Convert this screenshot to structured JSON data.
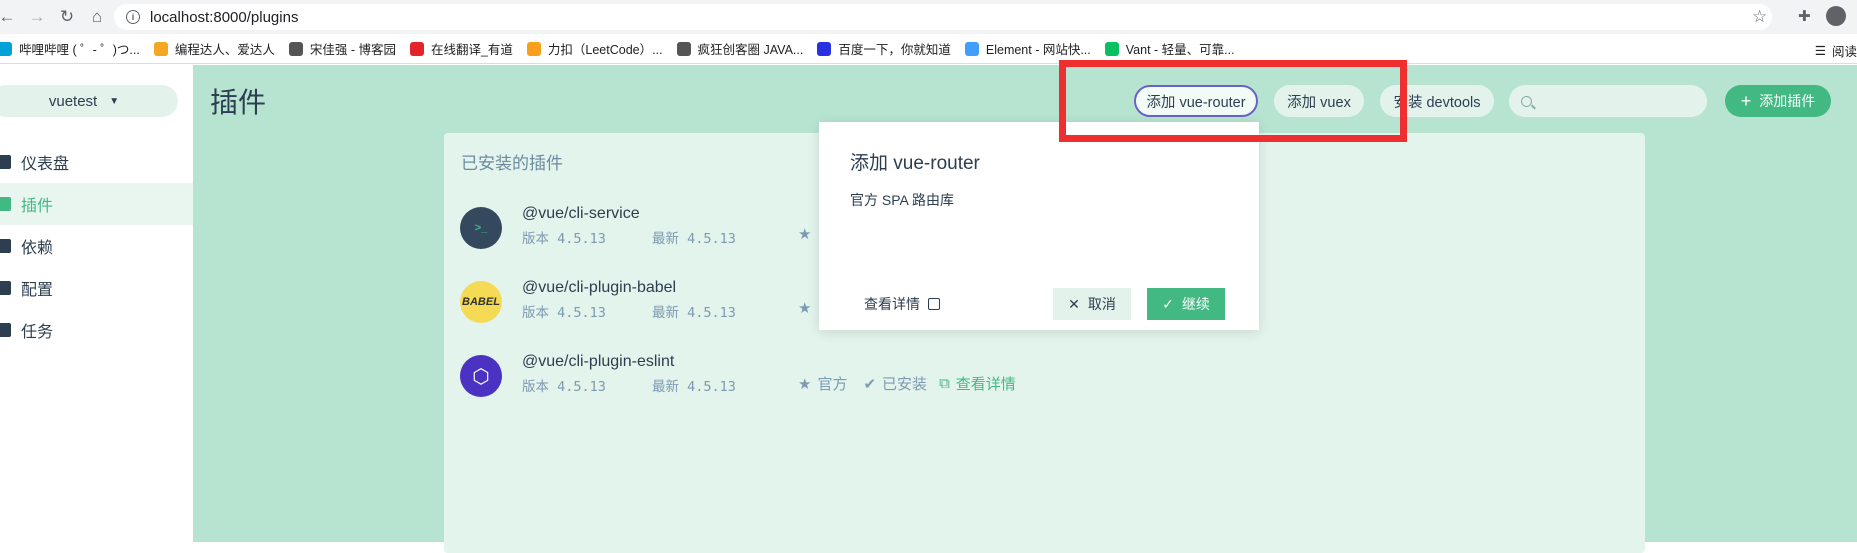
{
  "browser": {
    "url": "localhost:8000/plugins",
    "bookmarks": [
      {
        "label": "哔哩哔哩 ( ゜- ゜)つ...",
        "color": "#00a1d6"
      },
      {
        "label": "编程达人、爱达人",
        "color": "#f5a623"
      },
      {
        "label": "宋佳强 - 博客园",
        "color": "#333333"
      },
      {
        "label": "在线翻译_有道",
        "color": "#e3242b"
      },
      {
        "label": "力扣（LeetCode）...",
        "color": "#222222"
      },
      {
        "label": "疯狂创客圈 JAVA...",
        "color": "#333333"
      },
      {
        "label": "百度一下，你就知道",
        "color": "#2932e1"
      },
      {
        "label": "Element - 网站快...",
        "color": "#409eff"
      },
      {
        "label": "Vant - 轻量、可靠...",
        "color": "#07c160"
      }
    ],
    "reading_list": "阅读"
  },
  "sidebar": {
    "project": "vuetest",
    "items": [
      {
        "label": "仪表盘",
        "icon": "dashboard-icon"
      },
      {
        "label": "插件",
        "icon": "plugin-icon"
      },
      {
        "label": "依赖",
        "icon": "dependency-icon"
      },
      {
        "label": "配置",
        "icon": "config-icon"
      },
      {
        "label": "任务",
        "icon": "task-icon"
      }
    ],
    "active": "插件"
  },
  "header": {
    "title": "插件",
    "add_router": "添加 vue-router",
    "add_vuex": "添加 vuex",
    "install_devtools": "安装 devtools",
    "search_placeholder": "",
    "add_plugin": "添加插件"
  },
  "panel": {
    "title": "已安装的插件",
    "plugins": [
      {
        "name": "@vue/cli-service",
        "version": "版本 4.5.13",
        "latest": "最新 4.5.13",
        "logo_text": ">_",
        "logo_bg": "#35495e",
        "logo_fg": "#42b983"
      },
      {
        "name": "@vue/cli-plugin-babel",
        "version": "版本 4.5.13",
        "latest": "最新 4.5.13",
        "logo_text": "BABEL",
        "logo_bg": "#f5da55",
        "logo_fg": "#323330"
      },
      {
        "name": "@vue/cli-plugin-eslint",
        "version": "版本 4.5.13",
        "latest": "最新 4.5.13",
        "logo_text": "⬡",
        "logo_bg": "#4b32c3",
        "logo_fg": "#ffffff",
        "official": "官方",
        "installed": "已安装",
        "detail": "查看详情"
      }
    ]
  },
  "popover": {
    "title": "添加 vue-router",
    "description": "官方 SPA 路由库",
    "details_link": "查看详情",
    "cancel": "取消",
    "continue": "继续"
  },
  "colors": {
    "accent": "#42b983",
    "highlight": "#ee2f2f",
    "background": "#b7e4d0"
  }
}
